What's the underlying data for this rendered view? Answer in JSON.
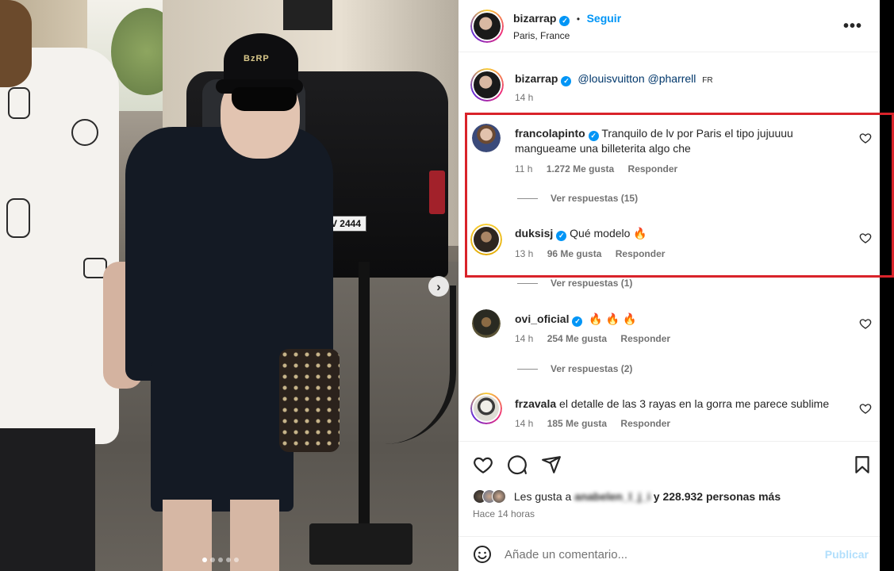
{
  "post": {
    "author": "bizarrap",
    "follow_label": "Seguir",
    "separator": "•",
    "location": "Paris, France",
    "more_label": "•••"
  },
  "caption": {
    "author": "bizarrap",
    "mentions": "@louisvuitton @pharrell",
    "lang": "FR",
    "time": "14 h"
  },
  "comments": [
    {
      "user": "francolapinto",
      "verified": true,
      "text": "Tranquilo de lv por Paris el tipo jujuuuu mangueame una billeterita algo che",
      "time": "11 h",
      "likes": "1.272 Me gusta",
      "reply": "Responder",
      "view_replies": "Ver respuestas (15)"
    },
    {
      "user": "duksisj",
      "verified": true,
      "text": "Qué modelo 🔥",
      "time": "13 h",
      "likes": "96 Me gusta",
      "reply": "Responder",
      "view_replies": "Ver respuestas (1)"
    },
    {
      "user": "ovi_oficial",
      "verified": true,
      "text": "🔥 🔥 🔥",
      "time": "14 h",
      "likes": "254 Me gusta",
      "reply": "Responder",
      "view_replies": "Ver respuestas (2)"
    },
    {
      "user": "frzavala",
      "verified": false,
      "text": "el detalle de las 3 rayas en la gorra me parece sublime",
      "time": "14 h",
      "likes": "185 Me gusta",
      "reply": "Responder"
    }
  ],
  "likes": {
    "prefix": "Les gusta a",
    "hidden_user": "anabelen_l_j_i",
    "suffix": "y 228.932 personas más",
    "time_ago": "Hace 14 horas"
  },
  "add_comment": {
    "placeholder": "Añade un comentario...",
    "publish": "Publicar"
  },
  "photo": {
    "cap_text": "BzRP",
    "plate": "V 2444",
    "next_label": "›",
    "carousel_count": 5,
    "carousel_active": 1
  },
  "icons": {
    "heart": "heart-icon",
    "comment": "comment-icon",
    "share": "share-icon",
    "save": "bookmark-icon",
    "emoji": "emoji-icon",
    "more": "more-icon"
  },
  "colors": {
    "link": "#00376b",
    "accent": "#0095f6",
    "highlight_box": "#d9232a",
    "publish_disabled": "#b2dffc"
  }
}
